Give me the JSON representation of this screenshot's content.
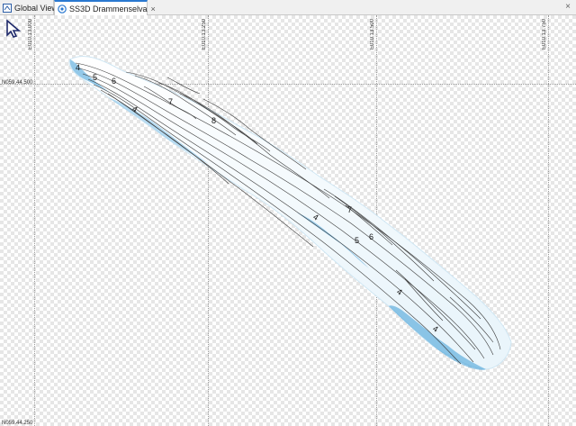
{
  "tabs": [
    {
      "label": "Global View",
      "icon": "globe-icon"
    },
    {
      "label": "SS3D Drammenselva",
      "icon": "ss3d-icon",
      "close": "×"
    }
  ],
  "window_close": "×",
  "grid": {
    "easting_labels": [
      "E010.13.000",
      "E010.13.250",
      "E010.13.500",
      "E010.13.750"
    ],
    "northing_labels": [
      "N059.44.500",
      "N059.44.250"
    ]
  },
  "depth_labels": [
    "4",
    "5",
    "6",
    "4",
    "7",
    "8",
    "4",
    "7",
    "5",
    "6",
    "4",
    "4"
  ],
  "colors": {
    "shallow": "#ffffff",
    "deep": "#2a8fd0",
    "contour": "#333333",
    "active_tab": "#2b79d0"
  },
  "icons": {
    "pointer": "arrow-cursor-icon"
  }
}
